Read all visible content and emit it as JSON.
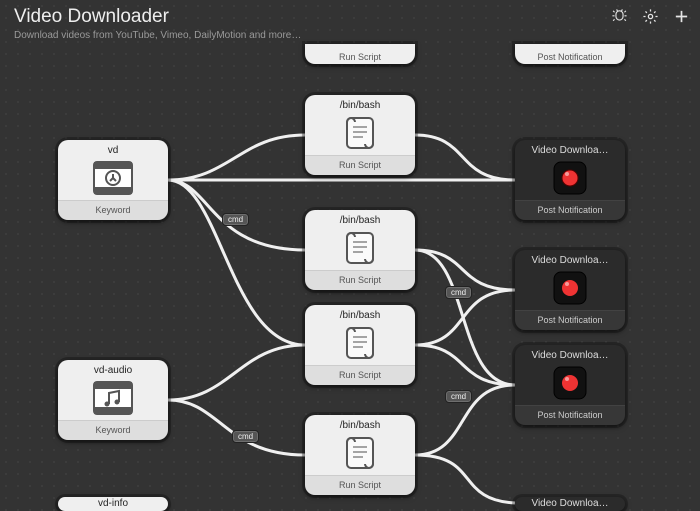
{
  "header": {
    "title": "Video Downloader",
    "subtitle": "Download videos from YouTube, Vimeo, DailyMotion and more…"
  },
  "toolbar": {
    "debug_tooltip": "Debug",
    "settings_tooltip": "Settings",
    "add_tooltip": "Add"
  },
  "labels": {
    "keyword": "Keyword",
    "run_script": "Run Script",
    "post_notification": "Post Notification",
    "cmd": "cmd"
  },
  "nodes": {
    "stub_script_top": {
      "sub_key": "run_script"
    },
    "stub_notify_top": {
      "sub_key": "post_notification"
    },
    "vd": {
      "title": "vd",
      "sub_key": "keyword",
      "icon": "keyword-video"
    },
    "vd_audio": {
      "title": "vd-audio",
      "sub_key": "keyword",
      "icon": "keyword-audio"
    },
    "vd_info_stub": {
      "title": "vd-info"
    },
    "bash1": {
      "title": "/bin/bash",
      "sub_key": "run_script",
      "icon": "scroll"
    },
    "bash2": {
      "title": "/bin/bash",
      "sub_key": "run_script",
      "icon": "scroll"
    },
    "bash3": {
      "title": "/bin/bash",
      "sub_key": "run_script",
      "icon": "scroll"
    },
    "bash4": {
      "title": "/bin/bash",
      "sub_key": "run_script",
      "icon": "scroll"
    },
    "notify1": {
      "title": "Video Downloa…",
      "sub_key": "post_notification",
      "icon": "record"
    },
    "notify2": {
      "title": "Video Downloa…",
      "sub_key": "post_notification",
      "icon": "record"
    },
    "notify3": {
      "title": "Video Downloa…",
      "sub_key": "post_notification",
      "icon": "record"
    },
    "notify4_stub": {
      "title": "Video Downloa…"
    }
  }
}
